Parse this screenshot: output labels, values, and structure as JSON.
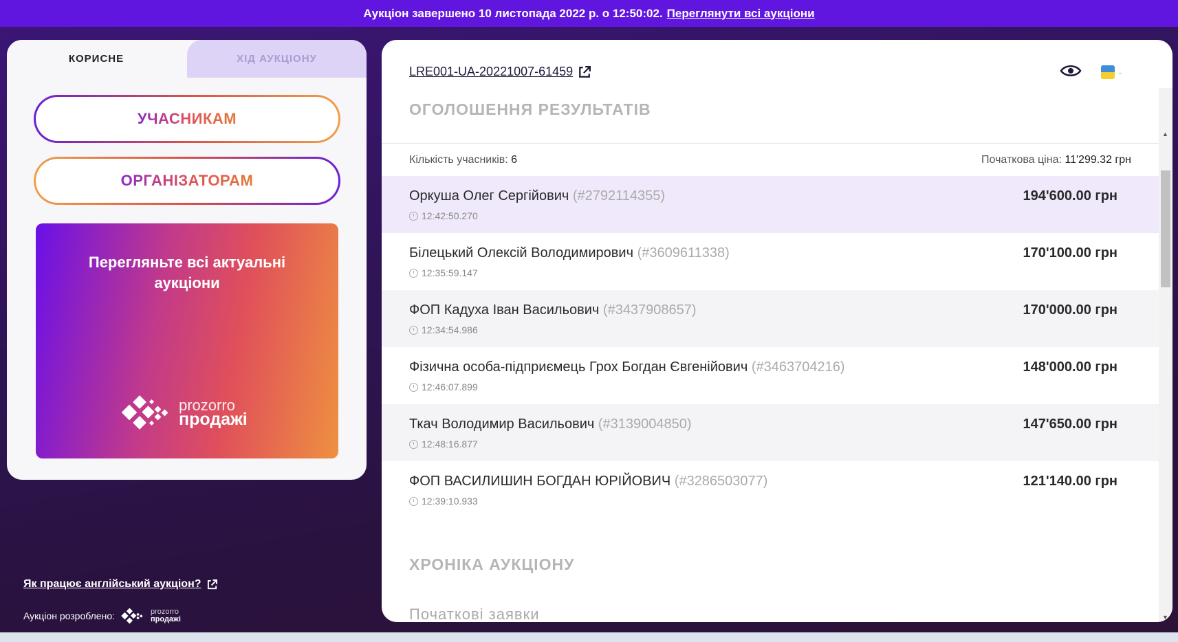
{
  "banner": {
    "text": "Аукціон завершено 10 листопада 2022 р. о 12:50:02.",
    "link": "Переглянути всі аукціони"
  },
  "left": {
    "tabs": [
      {
        "label": "КОРИСНЕ"
      },
      {
        "label": "ХІД АУКЦІОНУ"
      }
    ],
    "buttons": [
      {
        "label": "УЧАСНИКАМ"
      },
      {
        "label": "ОРГАНІЗАТОРАМ"
      }
    ],
    "promo": {
      "text": "Перегляньте всі актуальні аукціони",
      "logo_line1": "prozorro",
      "logo_line2": "продажі"
    },
    "how_link": "Як працює англійський аукціон?",
    "dev_by": "Аукціон розроблено:",
    "dev_logo_line1": "prozorro",
    "dev_logo_line2": "продажі"
  },
  "main": {
    "lot_id": "LRE001-UA-20221007-61459",
    "results_title": "ОГОЛОШЕННЯ РЕЗУЛЬТАТІВ",
    "participants_label": "Кількість учасників:",
    "participants_count": "6",
    "start_price_label": "Початкова ціна:",
    "start_price": "11'299.32 грн",
    "bids": [
      {
        "name": "Оркуша Олег Сергійович",
        "id": "(#2792114355)",
        "time": "12:42:50.270",
        "amount": "194'600.00 грн"
      },
      {
        "name": "Білецький Олексій Володимирович",
        "id": "(#3609611338)",
        "time": "12:35:59.147",
        "amount": "170'100.00 грн"
      },
      {
        "name": "ФОП Кадуха Іван Васильович",
        "id": "(#3437908657)",
        "time": "12:34:54.986",
        "amount": "170'000.00 грн"
      },
      {
        "name": "Фізична особа-підприємець Грох Богдан Євгенійович",
        "id": "(#3463704216)",
        "time": "12:46:07.899",
        "amount": "148'000.00 грн"
      },
      {
        "name": "Ткач Володимир Васильович",
        "id": "(#3139004850)",
        "time": "12:48:16.877",
        "amount": "147'650.00 грн"
      },
      {
        "name": "ФОП ВАСИЛИШИН БОГДАН ЮРІЙОВИЧ",
        "id": "(#3286503077)",
        "time": "12:39:10.933",
        "amount": "121'140.00 грн"
      }
    ],
    "chronicle_title": "ХРОНІКА АУКЦІОНУ",
    "initial_bids_title": "Початкові заявки"
  }
}
